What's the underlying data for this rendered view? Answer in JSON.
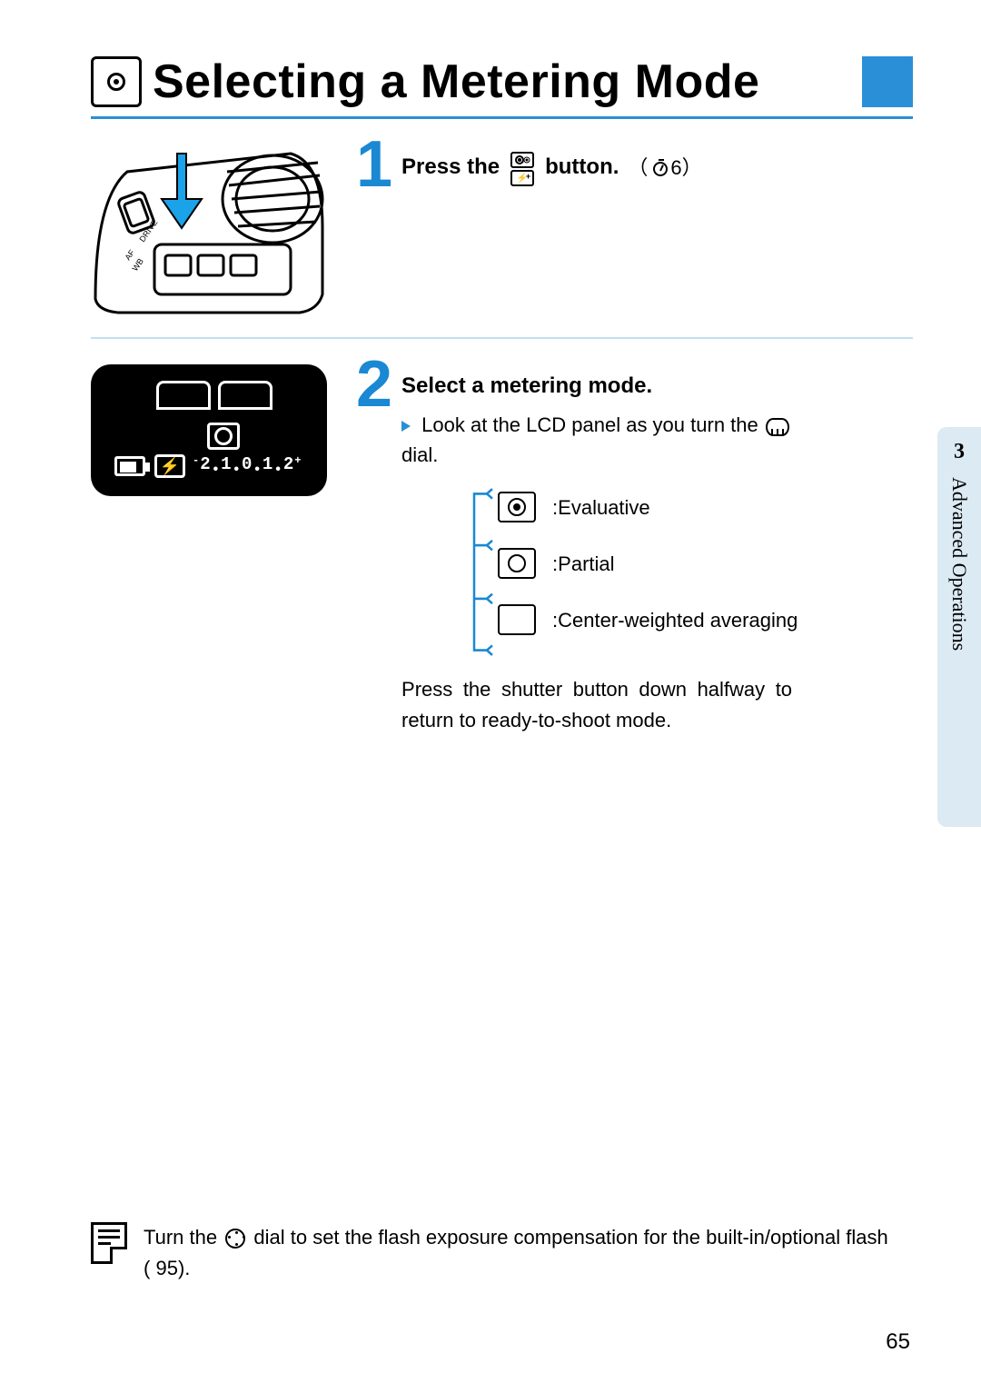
{
  "title": "Selecting a Metering Mode",
  "step1": {
    "num": "1",
    "text_before": "Press the",
    "text_after": "button.",
    "timer_value": "6"
  },
  "step2": {
    "num": "2",
    "headline": "Select a metering mode.",
    "bullet_text_before": "Look at the LCD panel as you turn the",
    "bullet_text_after": "dial.",
    "modes": {
      "evaluative": ":Evaluative",
      "partial": ":Partial",
      "center": ":Center-weighted averaging"
    },
    "closing": "Press the shutter button down halfway to return to ready-to-shoot mode."
  },
  "lcd": {
    "scale": "-2.1.0.1.2+",
    "flash_glyph": "⚡"
  },
  "side_tab": {
    "num": "3",
    "text": "Advanced Operations"
  },
  "footer": {
    "text_before": "Turn the",
    "text_mid": "dial to set the flash exposure compensation for the built-in/optional flash (",
    "page_ref": "95",
    "text_after": ")."
  },
  "page_number": "65"
}
